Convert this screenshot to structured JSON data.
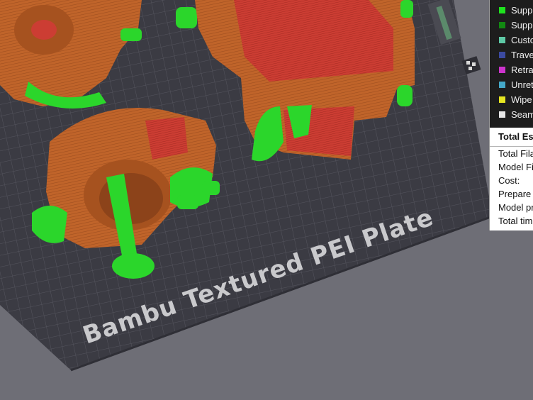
{
  "plate": {
    "label": "Bambu Textured PEI Plate"
  },
  "legend": {
    "items": [
      {
        "label": "Suppo",
        "color": "#1ee31e"
      },
      {
        "label": "Suppo",
        "color": "#128a12"
      },
      {
        "label": "Custo",
        "color": "#5ec9a6"
      },
      {
        "label": "Trave",
        "color": "#3b4aa0"
      },
      {
        "label": "Retra",
        "color": "#cc33cc"
      },
      {
        "label": "Unret",
        "color": "#44a8c8"
      },
      {
        "label": "Wipe",
        "color": "#e6e622"
      },
      {
        "label": "Seam",
        "color": "#e6e6e6"
      }
    ]
  },
  "summary": {
    "title": "Total Est",
    "rows": [
      "Total Fila",
      "Model Fi",
      "Cost:",
      "Prepare",
      "Model pr",
      "Total tim"
    ]
  },
  "colors": {
    "model": "#c0642a",
    "support": "#2bd62b",
    "infill": "#c83a30",
    "bed": "#3b3b43"
  }
}
